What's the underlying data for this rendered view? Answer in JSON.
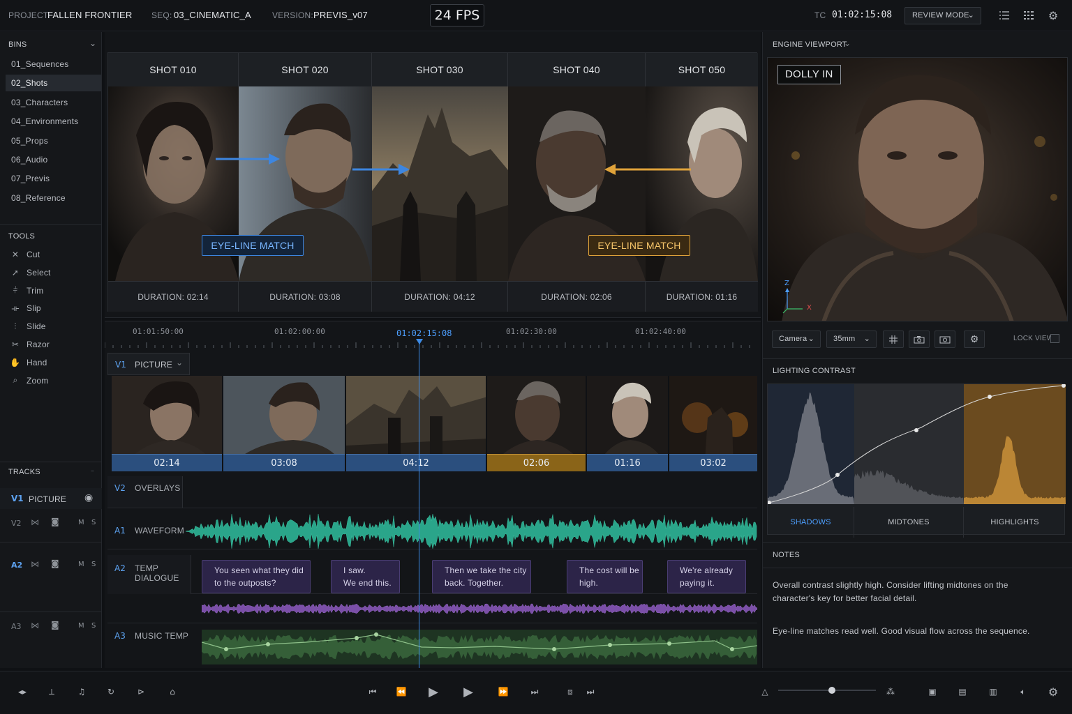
{
  "topbar": {
    "project_label": "PROJECT:",
    "project_value": "FALLEN FRONTIER",
    "seq_label": "SEQ:",
    "seq_value": "03_CINEMATIC_A",
    "version_label": "VERSION:",
    "version_value": "PREVIS_v07",
    "fps": "24 FPS",
    "tc_label": "TC",
    "tc_value": "01:02:15:08",
    "review_mode": "REVIEW MODE",
    "icons": [
      "list-view-icon",
      "grid-view-icon",
      "gear-icon"
    ]
  },
  "bins": {
    "title": "BINS",
    "items": [
      "01_Sequences",
      "02_Shots",
      "03_Characters",
      "04_Environments",
      "05_Props",
      "06_Audio",
      "07_Previs",
      "08_Reference"
    ],
    "selected": "02_Shots"
  },
  "tools": {
    "title": "TOOLS",
    "items": [
      {
        "label": "Cut",
        "icon": "cut-icon"
      },
      {
        "label": "Select",
        "icon": "select-arrow-icon"
      },
      {
        "label": "Trim",
        "icon": "trim-icon"
      },
      {
        "label": "Slip",
        "icon": "slip-icon"
      },
      {
        "label": "Slide",
        "icon": "slide-icon"
      },
      {
        "label": "Razor",
        "icon": "razor-icon"
      },
      {
        "label": "Hand",
        "icon": "hand-icon"
      },
      {
        "label": "Zoom",
        "icon": "zoom-icon"
      }
    ]
  },
  "tracks_panel": {
    "title": "TRACKS",
    "v1": {
      "id": "V1",
      "name": "PICTURE"
    },
    "v2": {
      "id": "V2"
    },
    "a2": {
      "id": "A2"
    },
    "a3": {
      "id": "A3"
    },
    "m": "M",
    "s": "S"
  },
  "storyboard": {
    "shots": [
      {
        "title": "SHOT 010",
        "duration": "DURATION: 02:14"
      },
      {
        "title": "SHOT 020",
        "duration": "DURATION: 03:08"
      },
      {
        "title": "SHOT 030",
        "duration": "DURATION: 04:12"
      },
      {
        "title": "SHOT 040",
        "duration": "DURATION: 02:06"
      },
      {
        "title": "SHOT 050",
        "duration": "DURATION: 01:16"
      }
    ],
    "eyeline_left": "EYE-LINE MATCH",
    "eyeline_right": "EYE-LINE MATCH",
    "colors": {
      "blue": "#3d86e0",
      "gold": "#e0a33a"
    }
  },
  "ruler": {
    "ticks": [
      "01:01:50:00",
      "01:02:00:00",
      "01:02:15:08",
      "01:02:30:00",
      "01:02:40:00"
    ],
    "playhead": "01:02:15:08"
  },
  "timeline": {
    "v1": {
      "id": "V1",
      "name": "PICTURE"
    },
    "v2": {
      "id": "V2",
      "name": "OVERLAYS"
    },
    "a1": {
      "id": "A1",
      "name": "WAVEFORM"
    },
    "a2": {
      "id": "A2",
      "name": "TEMP DIALOGUE"
    },
    "a3": {
      "id": "A3",
      "name": "MUSIC TEMP"
    },
    "clips": [
      "02:14",
      "03:08",
      "04:12",
      "02:06",
      "01:16",
      "03:02"
    ],
    "dialogue": [
      {
        "l1": "You seen what they did",
        "l2": "to the outposts?"
      },
      {
        "l1": "I saw.",
        "l2": "We end this."
      },
      {
        "l1": "Then we take the city",
        "l2": "back. Together."
      },
      {
        "l1": "The cost will be",
        "l2": "high."
      },
      {
        "l1": "We're already",
        "l2": "paying it."
      }
    ]
  },
  "viewport": {
    "title": "ENGINE VIEWPORT",
    "badge": "DOLLY IN",
    "axis_z": "Z",
    "axis_x": "X",
    "camera": "Camera",
    "lens": "35mm",
    "lock_view": "LOCK VIEW",
    "icons": [
      "grid-overlay-icon",
      "camera-icon",
      "snapshot-icon",
      "gear-icon"
    ]
  },
  "lighting": {
    "title": "LIGHTING CONTRAST",
    "zones": [
      "SHADOWS",
      "MIDTONES",
      "HIGHLIGHTS"
    ],
    "active_zone": "SHADOWS",
    "colors": {
      "shadows": "#4d9fff",
      "highlights": "#c9913a"
    }
  },
  "notes": {
    "title": "NOTES",
    "p1_l1": "Overall contrast slightly high. Consider lifting midtones on the",
    "p1_l2": "character's key for better facial detail.",
    "p2": "Eye-line matches read well. Good visual flow across the sequence."
  },
  "transport": {
    "left_icons": [
      "audio-scrub-icon",
      "snap-icon",
      "music-note-icon",
      "loop-icon",
      "trim-mode-icon",
      "home-icon"
    ],
    "center_icons": [
      "go-to-start-icon",
      "rewind-icon",
      "play-reverse-icon",
      "play-icon",
      "fast-forward-icon",
      "go-to-end-icon",
      "mark-in-icon",
      "mark-out-icon"
    ],
    "right_icons": [
      "zoom-out-icon",
      "zoom-in-icon",
      "layout-1-icon",
      "layout-2-icon",
      "layout-3-icon",
      "volume-icon",
      "gear-icon"
    ],
    "zoom_level": 0.55
  }
}
